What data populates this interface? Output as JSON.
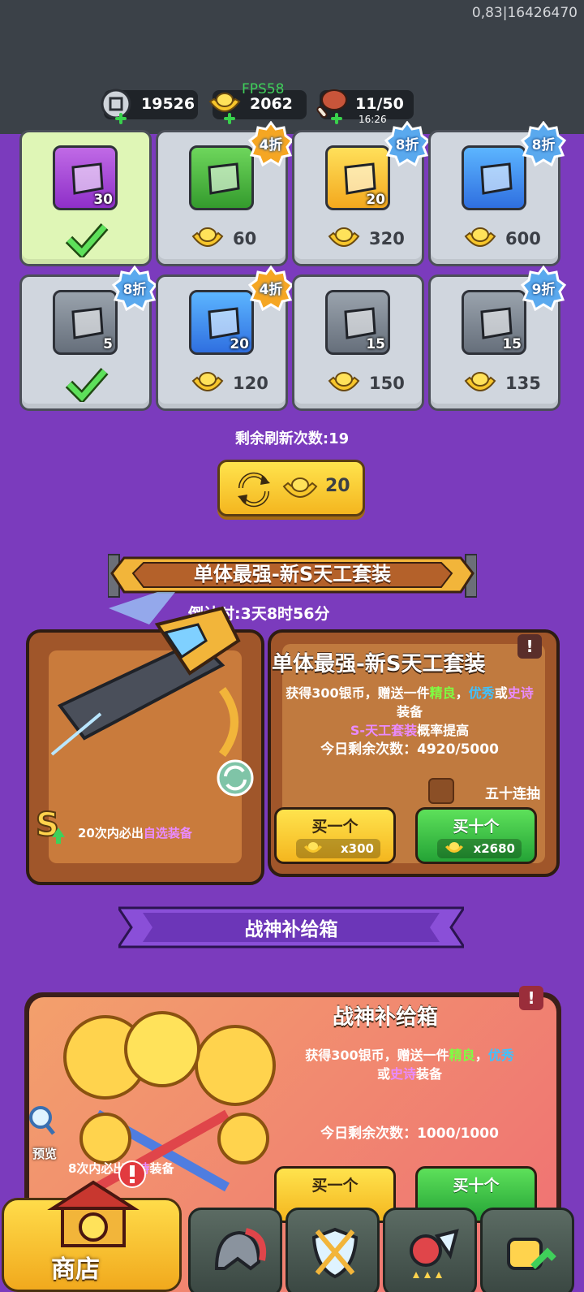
{
  "status": {
    "debug_text": "0,83|16426470",
    "fps": "FPS58"
  },
  "resources": {
    "silver": "19526",
    "gold": "2062",
    "stamina": "11/50",
    "stamina_timer": "16:26"
  },
  "shop_grid": [
    {
      "qty": "30",
      "price": "",
      "badge": "",
      "purchased": true
    },
    {
      "qty": "",
      "price": "60",
      "badge": "4折",
      "purchased": false
    },
    {
      "qty": "20",
      "price": "320",
      "badge": "8折",
      "purchased": false
    },
    {
      "qty": "",
      "price": "600",
      "badge": "8折",
      "purchased": false
    },
    {
      "qty": "5",
      "price": "",
      "badge": "8折",
      "purchased": true
    },
    {
      "qty": "20",
      "price": "120",
      "badge": "4折",
      "purchased": false
    },
    {
      "qty": "15",
      "price": "150",
      "badge": "",
      "purchased": false
    },
    {
      "qty": "15",
      "price": "135",
      "badge": "9折",
      "purchased": false
    }
  ],
  "refresh": {
    "remaining_label": "剩余刷新次数:19",
    "cost": "20"
  },
  "event": {
    "banner_title": "单体最强-新S天工套装",
    "countdown": "倒计时:3天8时56分",
    "card_title": "单体最强-新S天工套装",
    "desc_part1": "获得300银币，赠送一件",
    "desc_good": "精良",
    "desc_comma": "，",
    "desc_excellent": "优秀",
    "desc_or": "或",
    "desc_epic": "史诗",
    "desc_equip": "装备",
    "desc_rate_prefix": "S-天工套装",
    "desc_rate_suffix": "概率提高",
    "daily_label": "今日剩余次数：4920/5000",
    "fifty_draw": "五十连抽",
    "guarantee_prefix": "20次内必出",
    "guarantee_highlight": "自选装备",
    "buy_one_label": "买一个",
    "buy_one_cost": "x300",
    "buy_ten_label": "买十个",
    "buy_ten_cost": "x2680"
  },
  "supply": {
    "banner_title": "战神补给箱",
    "card_title": "战神补给箱",
    "desc_part1": "获得300银币，赠送一件",
    "desc_good": "精良",
    "desc_comma": "，",
    "desc_excellent": "优秀",
    "desc_or": "或",
    "desc_epic": "史诗",
    "desc_equip": "装备",
    "daily_label": "今日剩余次数：1000/1000",
    "preview": "预览",
    "guarantee_prefix": "8次内必出",
    "guarantee_highlight": "史诗",
    "guarantee_suffix": "装备",
    "buy_one_label": "买一个",
    "buy_ten_label": "买十个"
  },
  "nav": {
    "shop_label": "商店"
  },
  "colors": {
    "background": "#7b3bbd",
    "topbar": "#3b4148",
    "accent_gold": "#f4b61f",
    "accent_green": "#24a336"
  }
}
